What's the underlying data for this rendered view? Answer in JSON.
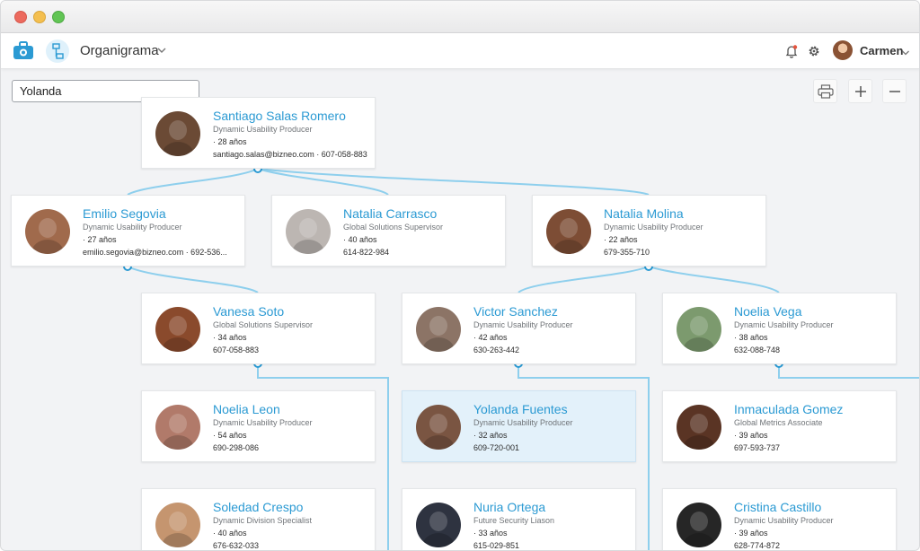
{
  "window": {
    "title": ""
  },
  "appbar": {
    "module_title": "Organigrama",
    "user_name": "Carmen"
  },
  "search": {
    "value": "Yolanda",
    "placeholder": ""
  },
  "colors": {
    "accent": "#2b9ad3",
    "connector": "#8ecfed",
    "highlight": "#e3f1fa"
  },
  "icons": {
    "app_logo": "toolbox-icon",
    "org_chart": "org-chart-icon",
    "bell": "bell-icon",
    "gear": "gear-icon",
    "print": "printer-icon",
    "zoom_in": "plus-icon",
    "zoom_out": "minus-icon"
  },
  "employees": [
    {
      "name": "Santiago Salas Romero",
      "role": "Dynamic Usability Producer",
      "age": "· 28 años",
      "contact": "santiago.salas@bizneo.com · 607-058-883"
    },
    {
      "name": "Emilio Segovia",
      "role": "Dynamic Usability Producer",
      "age": "· 27 años",
      "contact": "emilio.segovia@bizneo.com · 692-536..."
    },
    {
      "name": "Natalia Carrasco",
      "role": "Global Solutions Supervisor",
      "age": "· 40 años",
      "contact": "614-822-984"
    },
    {
      "name": "Natalia Molina",
      "role": "Dynamic Usability Producer",
      "age": "· 22 años",
      "contact": "679-355-710"
    },
    {
      "name": "Vanesa Soto",
      "role": "Global Solutions Supervisor",
      "age": "· 34 años",
      "contact": "607-058-883"
    },
    {
      "name": "Victor Sanchez",
      "role": "Dynamic Usability Producer",
      "age": "· 42 años",
      "contact": "630-263-442"
    },
    {
      "name": "Noelia Vega",
      "role": "Dynamic Usability Producer",
      "age": "· 38 años",
      "contact": "632-088-748"
    },
    {
      "name": "Noelia Leon",
      "role": "Dynamic Usability Producer",
      "age": "· 54 años",
      "contact": "690-298-086"
    },
    {
      "name": "Yolanda Fuentes",
      "role": "Dynamic Usability Producer",
      "age": "· 32 años",
      "contact": "609-720-001",
      "highlighted": true
    },
    {
      "name": "Inmaculada Gomez",
      "role": "Global Metrics Associate",
      "age": "· 39 años",
      "contact": "697-593-737"
    },
    {
      "name": "Soledad Crespo",
      "role": "Dynamic Division Specialist",
      "age": "· 40 años",
      "contact": "676-632-033"
    },
    {
      "name": "Nuria Ortega",
      "role": "Future Security Liason",
      "age": "· 33 años",
      "contact": "615-029-851"
    },
    {
      "name": "Cristina Castillo",
      "role": "Dynamic Usability Producer",
      "age": "· 39 años",
      "contact": "628-774-872"
    }
  ]
}
